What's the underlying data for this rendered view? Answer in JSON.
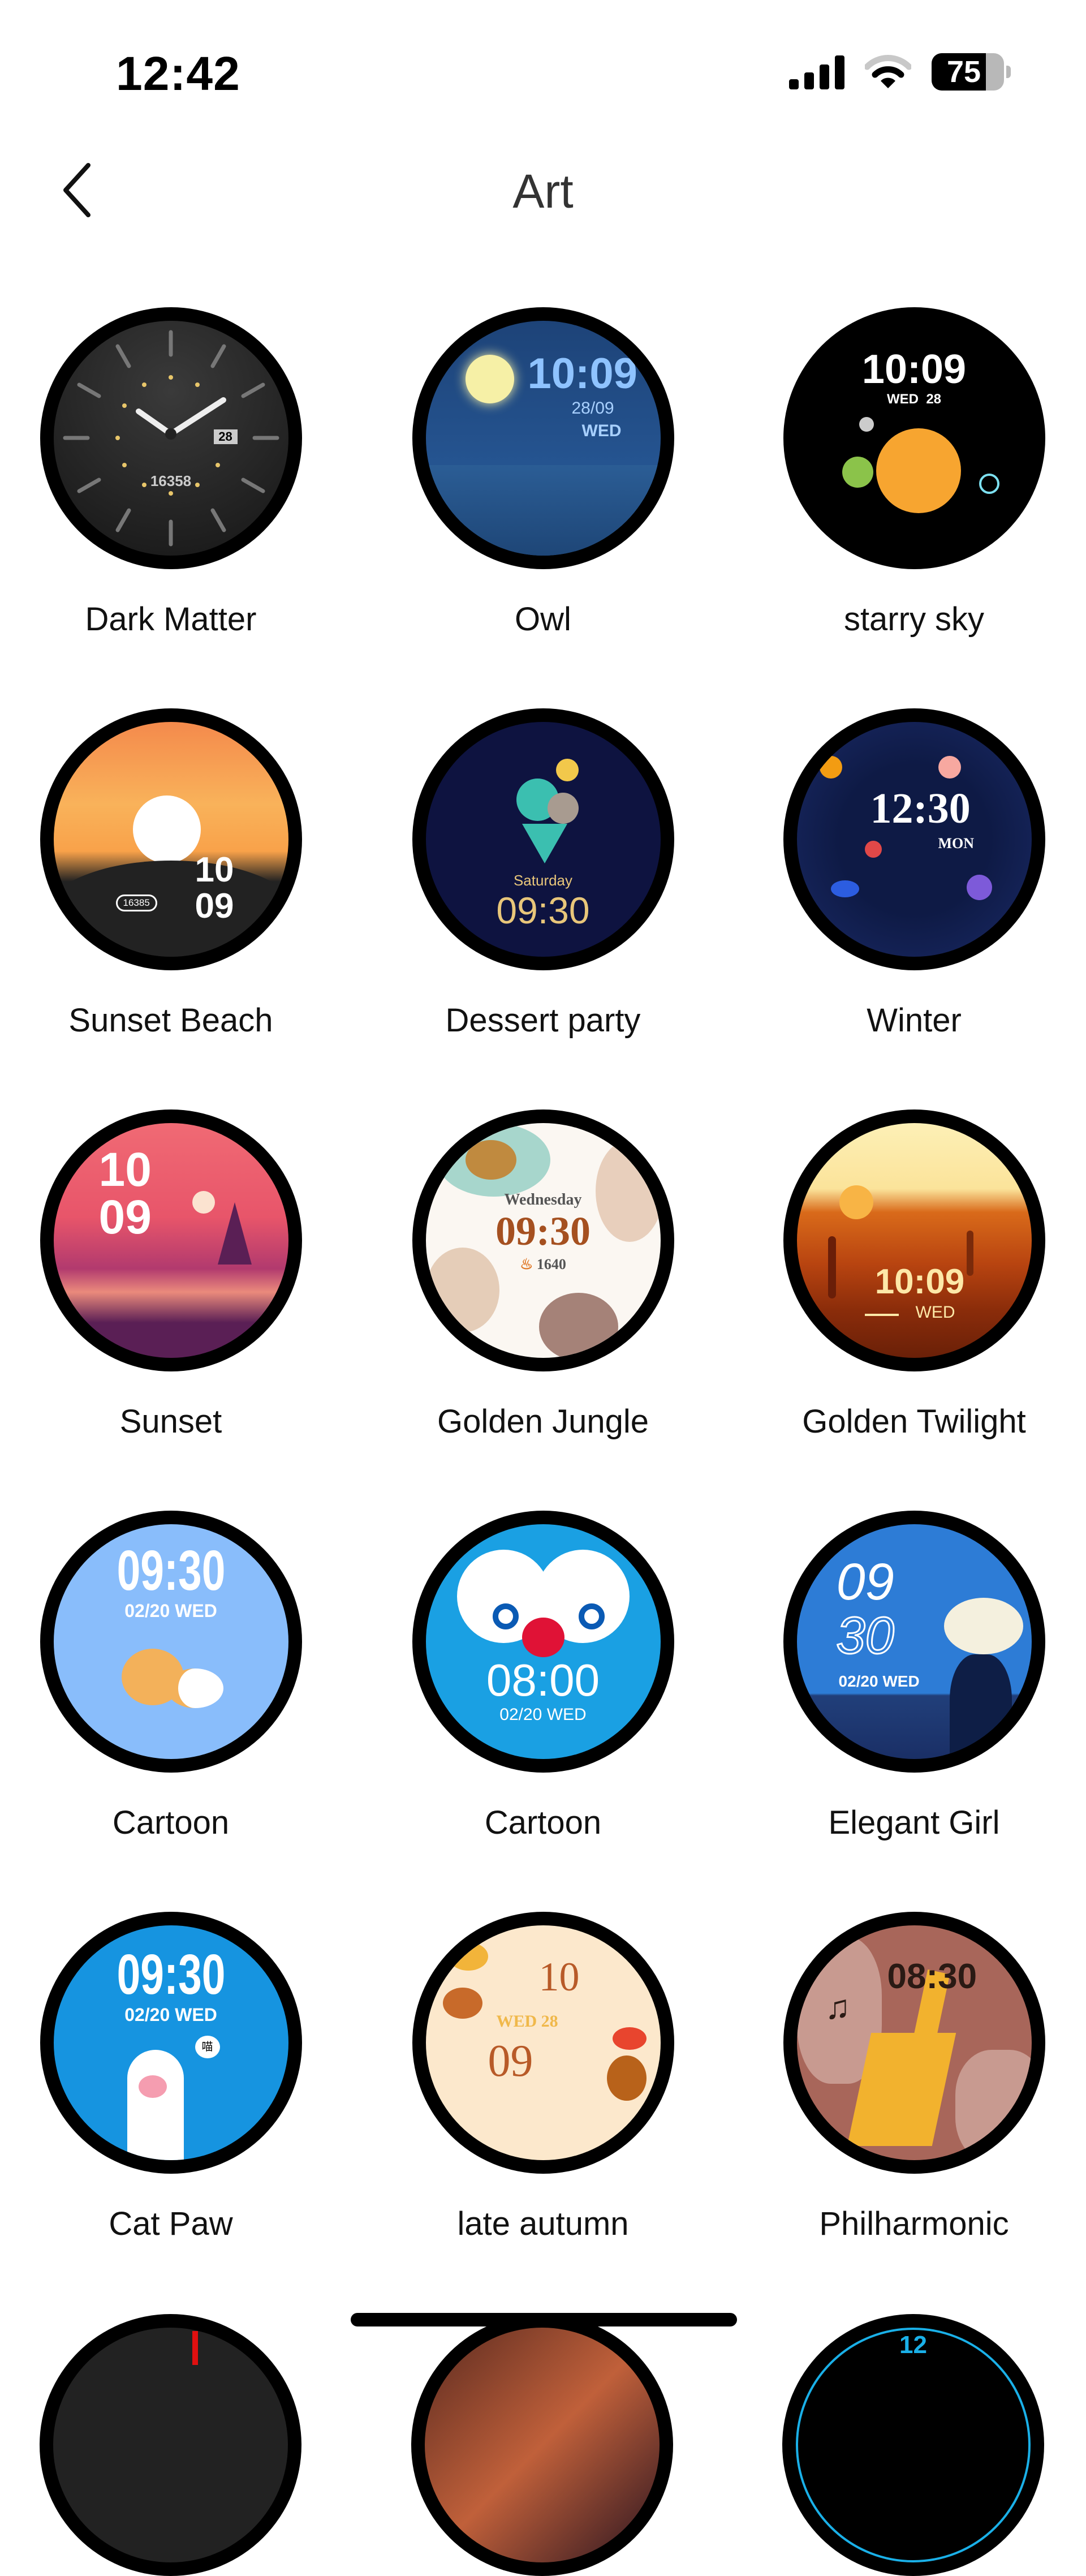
{
  "status_bar": {
    "time": "12:42",
    "battery_percent": 75,
    "battery_label": "75",
    "icons": [
      "cellular-signal-icon",
      "wifi-icon",
      "battery-icon"
    ]
  },
  "header": {
    "title": "Art",
    "back_icon": "chevron-left-icon"
  },
  "faces": [
    {
      "name": "Dark Matter",
      "time": "",
      "date": "28",
      "steps": "16358"
    },
    {
      "name": "Owl",
      "time": "10:09",
      "date": "28/09",
      "day": "WED"
    },
    {
      "name": "starry sky",
      "time": "10:09",
      "day": "WED",
      "date": "28"
    },
    {
      "name": "Sunset Beach",
      "time_h": "10",
      "time_m": "09",
      "steps": "16385"
    },
    {
      "name": "Dessert party",
      "day": "Saturday",
      "time": "09:30"
    },
    {
      "name": "Winter",
      "time": "12:30",
      "day": "MON"
    },
    {
      "name": "Sunset",
      "time_h": "10",
      "time_m": "09"
    },
    {
      "name": "Golden Jungle",
      "day": "Wednesday",
      "time": "09:30",
      "calories": "1640"
    },
    {
      "name": "Golden Twilight",
      "time": "10:09",
      "day": "WED"
    },
    {
      "name": "Cartoon",
      "time": "09:30",
      "date": "02/20 WED"
    },
    {
      "name": "Cartoon",
      "time": "08:00",
      "date": "02/20 WED"
    },
    {
      "name": "Elegant Girl",
      "time_h": "09",
      "time_m": "30",
      "date": "02/20 WED"
    },
    {
      "name": "Cat Paw",
      "time": "09:30",
      "date": "02/20 WED",
      "bubble": "喵"
    },
    {
      "name": "late autumn",
      "time_h": "10",
      "time_m": "09",
      "date": "WED 28"
    },
    {
      "name": "Philharmonic",
      "time": "08:30"
    }
  ],
  "partial_row": {
    "visible_text": "12"
  }
}
